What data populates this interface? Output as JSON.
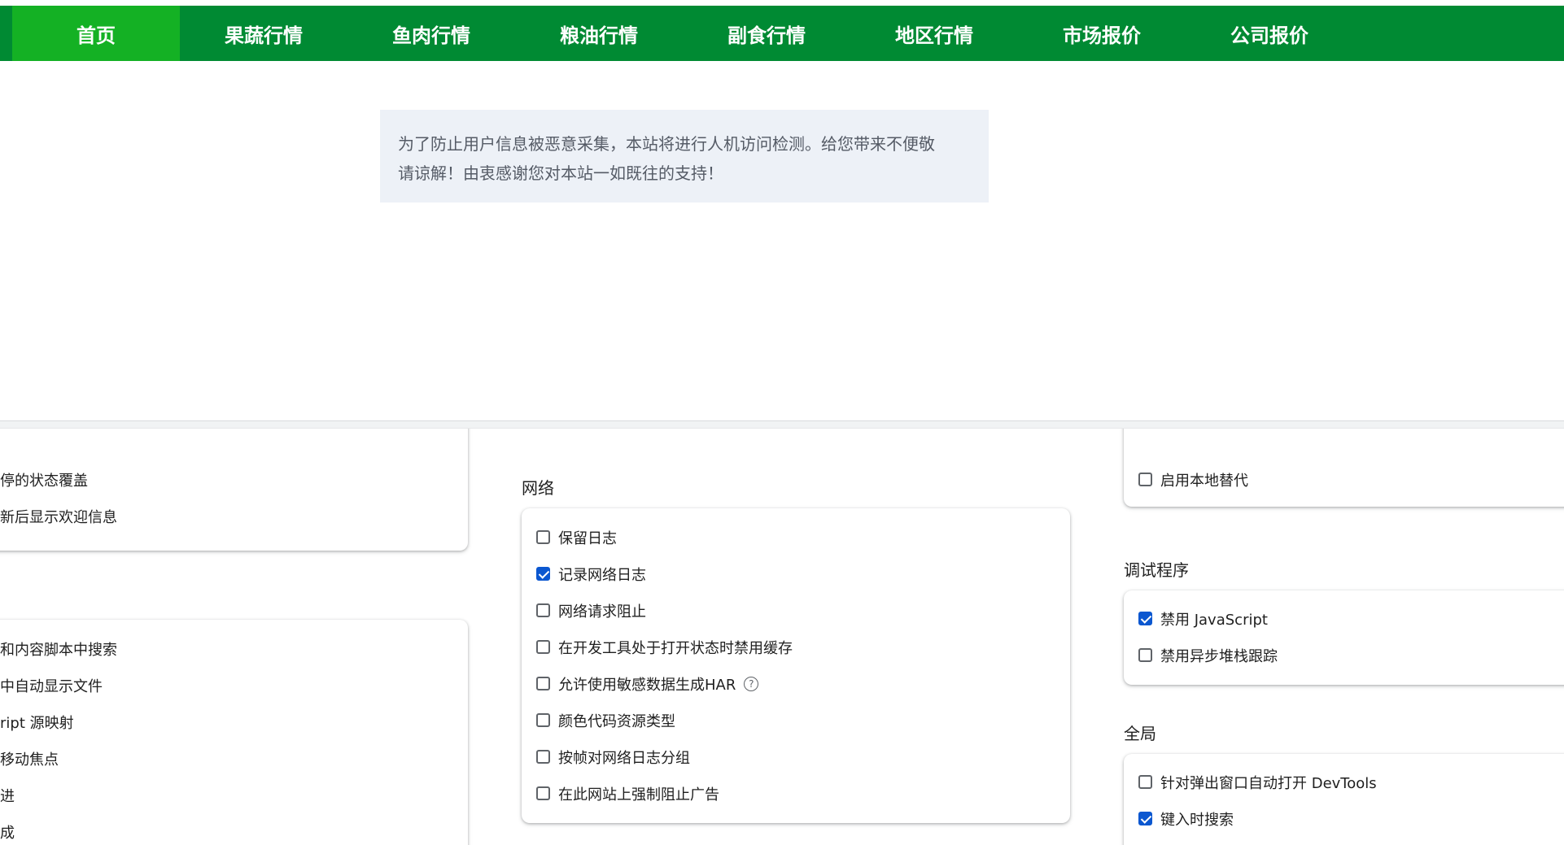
{
  "nav": {
    "items": [
      {
        "label": "首页",
        "active": true
      },
      {
        "label": "果蔬行情"
      },
      {
        "label": "鱼肉行情"
      },
      {
        "label": "粮油行情"
      },
      {
        "label": "副食行情"
      },
      {
        "label": "地区行情"
      },
      {
        "label": "市场报价"
      },
      {
        "label": "公司报价"
      }
    ]
  },
  "notice": {
    "line1": "为了防止用户信息被恶意采集，本站将进行人机访问检测。给您带来不便敬",
    "line2": "请谅解！由衷感谢您对本站一如既往的支持！"
  },
  "devtools": {
    "left_col": {
      "card1": [
        "停的状态覆盖",
        "新后显示欢迎信息"
      ],
      "card2": [
        "和内容脚本中搜索",
        "中自动显示文件",
        "ript 源映射",
        "移动焦点",
        "进",
        "成"
      ]
    },
    "network": {
      "title": "网络",
      "options": [
        {
          "label": "保留日志",
          "checked": false
        },
        {
          "label": "记录网络日志",
          "checked": true
        },
        {
          "label": "网络请求阻止",
          "checked": false
        },
        {
          "label": "在开发工具处于打开状态时禁用缓存",
          "checked": false
        },
        {
          "label": "允许使用敏感数据生成HAR",
          "checked": false,
          "help_icon": "help-icon"
        },
        {
          "label": "颜色代码资源类型",
          "checked": false
        },
        {
          "label": "按帧对网络日志分组",
          "checked": false
        },
        {
          "label": "在此网站上强制阻止广告",
          "checked": false
        }
      ]
    },
    "right_col": {
      "top_option": {
        "label": "启用本地替代",
        "checked": false
      },
      "debugger": {
        "title": "调试程序",
        "options": [
          {
            "label": "禁用 JavaScript",
            "checked": true
          },
          {
            "label": "禁用异步堆栈跟踪",
            "checked": false
          }
        ]
      },
      "global": {
        "title": "全局",
        "options": [
          {
            "label": "针对弹出窗口自动打开 DevTools",
            "checked": false
          },
          {
            "label": "键入时搜索",
            "checked": true
          }
        ]
      }
    }
  },
  "colors": {
    "nav_bg": "#008a33",
    "nav_active": "#14b124",
    "notice_bg": "#edf1f7",
    "checkbox_checked": "#0b57d0"
  }
}
